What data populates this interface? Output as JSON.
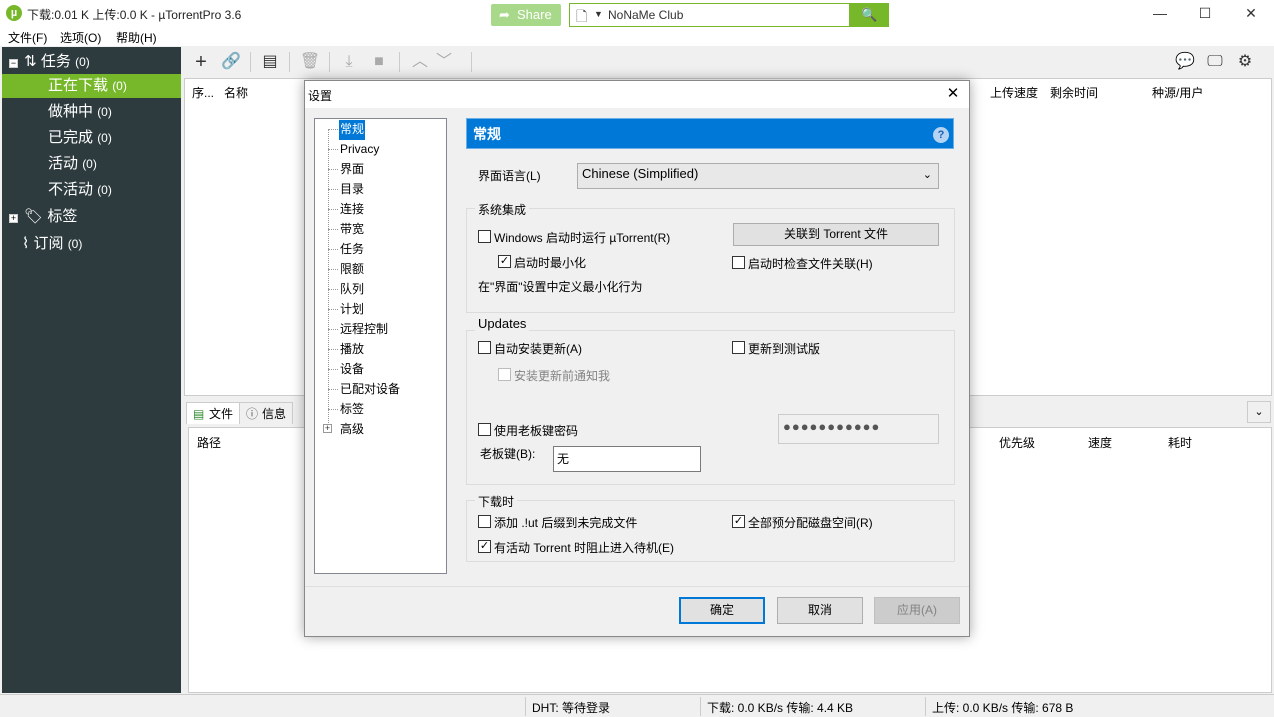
{
  "window": {
    "title": "下载:0.01 K 上传:0.0 K - µTorrentPro 3.6",
    "icon_glyph": "µ",
    "minimize": "—",
    "maximize": "☐",
    "close": "✕",
    "accent": "#76b82a"
  },
  "menu": {
    "file": "文件(F)",
    "options": "选项(O)",
    "help": "帮助(H)"
  },
  "sidebar": {
    "torrents": {
      "label": "任务",
      "count": "(0)"
    },
    "items": [
      {
        "label": "正在下载",
        "count": "(0)"
      },
      {
        "label": "做种中",
        "count": "(0)"
      },
      {
        "label": "已完成",
        "count": "(0)"
      },
      {
        "label": "活动",
        "count": "(0)"
      },
      {
        "label": "不活动",
        "count": "(0)"
      }
    ],
    "labels": {
      "label": "标签"
    },
    "feeds": {
      "label": "订阅",
      "count": "(0)"
    }
  },
  "toolbar": {
    "share_label": "Share",
    "search_value": "NoNaMe Club"
  },
  "list_columns": {
    "num": "序...",
    "name": "名称",
    "upload_speed": "上传速度",
    "eta": "剩余时间",
    "seeds_peers": "种源/用户"
  },
  "detail_tabs": {
    "files": "文件",
    "info": "信息"
  },
  "detail_columns": {
    "path": "路径",
    "priority": "优先级",
    "speed": "速度",
    "time": "耗时"
  },
  "status": {
    "dht": "DHT: 等待登录",
    "download": "下载: 0.0 KB/s 传输: 4.4 KB",
    "upload": "上传: 0.0 KB/s 传输: 678 B"
  },
  "dialog": {
    "title": "设置",
    "close": "✕",
    "tree": [
      "常规",
      "Privacy",
      "界面",
      "目录",
      "连接",
      "带宽",
      "任务",
      "限额",
      "队列",
      "计划",
      "远程控制",
      "播放",
      "设备",
      "已配对设备",
      "标签",
      "高级"
    ],
    "tree_expander": "+",
    "header_title": "常规",
    "help": "?",
    "language_label": "界面语言(L)",
    "language_value": "Chinese (Simplified)",
    "system_integration": {
      "title": "系统集成",
      "start_with_windows": "Windows 启动时运行 µTorrent(R)",
      "start_minimized": "启动时最小化",
      "associate_button": "关联到 Torrent 文件",
      "check_association": "启动时检查文件关联(H)",
      "note": "在\"界面\"设置中定义最小化行为"
    },
    "updates": {
      "title": "Updates",
      "auto_install": "自动安装更新(A)",
      "beta": "更新到测试版",
      "notify": "安装更新前通知我"
    },
    "boss_key": {
      "use_password": "使用老板键密码",
      "password_mask": "●●●●●●●●●●●",
      "key_label": "老板键(B):",
      "key_value": "无"
    },
    "when_downloading": {
      "title": "下载时",
      "append_ut": "添加 .!ut 后缀到未完成文件",
      "preallocate": "全部预分配磁盘空间(R)",
      "prevent_standby": "有活动 Torrent 时阻止进入待机(E)"
    },
    "buttons": {
      "ok": "确定",
      "cancel": "取消",
      "apply": "应用(A)"
    },
    "check_mark": "✓"
  }
}
